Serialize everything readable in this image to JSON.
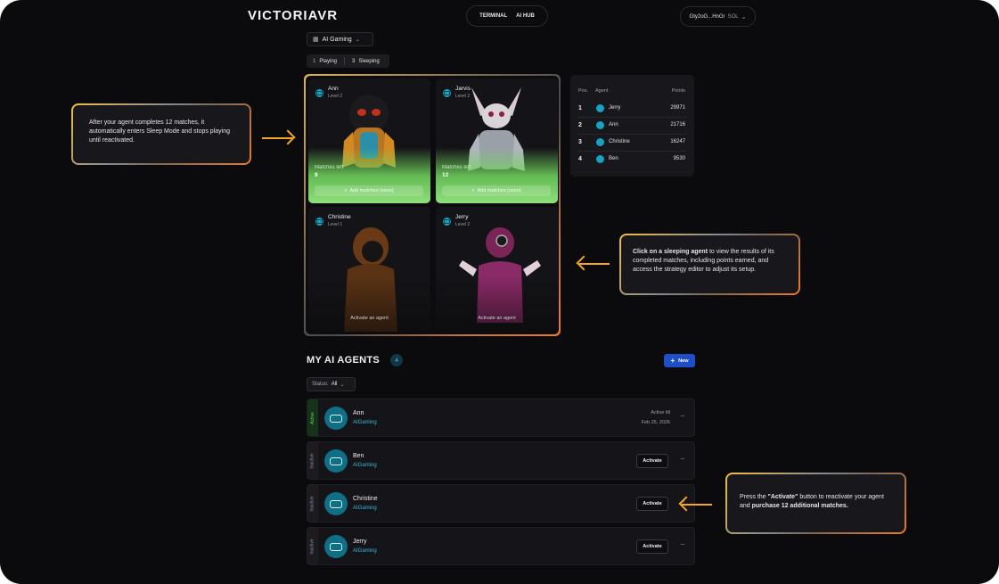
{
  "header": {
    "logo": "VICTORIAVR",
    "nav": [
      "TERMINAL",
      "AI HUB"
    ],
    "wallet_address": "Gty2oG...HnGr",
    "wallet_chain": "SOL"
  },
  "game_selector": {
    "label": "AI Gaming"
  },
  "filter": {
    "playing_count": "1",
    "playing_label": "Playing",
    "sleeping_count": "3",
    "sleeping_label": "Sleeping"
  },
  "cards": [
    {
      "name": "Ann",
      "level": "Level 2",
      "matches_label": "Matches left",
      "matches": "9",
      "add_label": "Add matches (soon)",
      "state": "active"
    },
    {
      "name": "Jarvis",
      "level": "Level 2",
      "matches_label": "Matches left",
      "matches": "12",
      "add_label": "Add matches (soon)",
      "state": "active"
    },
    {
      "name": "Christine",
      "level": "Level 1",
      "activate_label": "Activate an agent",
      "state": "sleep"
    },
    {
      "name": "Jerry",
      "level": "Level 2",
      "activate_label": "Activate an agent",
      "state": "sleep"
    }
  ],
  "leaderboard": {
    "headers": {
      "pos": "Pos.",
      "agent": "Agent",
      "points": "Points"
    },
    "rows": [
      {
        "pos": "1",
        "agent": "Jerry",
        "points": "29971"
      },
      {
        "pos": "2",
        "agent": "Ann",
        "points": "21716"
      },
      {
        "pos": "3",
        "agent": "Christine",
        "points": "16247"
      },
      {
        "pos": "4",
        "agent": "Ben",
        "points": "9530"
      }
    ]
  },
  "my_agents": {
    "title": "MY AI AGENTS",
    "count": "4",
    "new_label": "New",
    "status_label": "Status:",
    "status_value": "All",
    "rows": [
      {
        "name": "Ann",
        "game": "AIGaming",
        "status": "Active",
        "active_till": "Active till",
        "date": "Feb 25, 2026"
      },
      {
        "name": "Ben",
        "game": "AIGaming",
        "status": "Inactive",
        "button": "Activate"
      },
      {
        "name": "Christine",
        "game": "AIGaming",
        "status": "Inactive",
        "button": "Activate"
      },
      {
        "name": "Jerry",
        "game": "AIGaming",
        "status": "Inactive",
        "button": "Activate"
      }
    ]
  },
  "callouts": {
    "sleep_mode": "After your agent completes 12 matches, it automatically enters Sleep Mode and stops playing until reactivated.",
    "sleeping_bold": "Click on a sleeping agent",
    "sleeping_rest": " to view the results of its completed matches, including points earned, and access the strategy editor to adjust its setup.",
    "activate_pre": "Press the ",
    "activate_bold1": "\"Activate\"",
    "activate_mid": " button to reactivate your agent and ",
    "activate_bold2": "purchase 12 additional matches."
  },
  "colors": {
    "accent": "#f5a623",
    "cyan": "#15a3c4",
    "green": "#8ee07a",
    "blue": "#1e4fc8"
  }
}
